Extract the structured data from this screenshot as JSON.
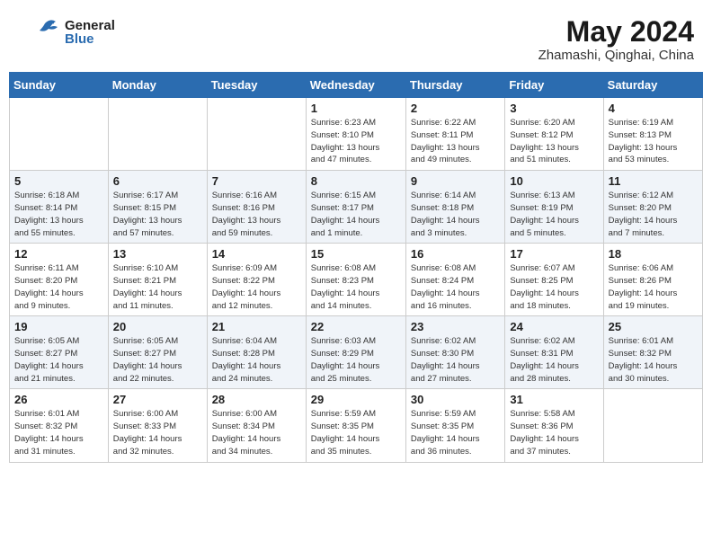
{
  "header": {
    "logo_general": "General",
    "logo_blue": "Blue",
    "month": "May 2024",
    "location": "Zhamashi, Qinghai, China"
  },
  "days_of_week": [
    "Sunday",
    "Monday",
    "Tuesday",
    "Wednesday",
    "Thursday",
    "Friday",
    "Saturday"
  ],
  "weeks": [
    [
      {
        "day": "",
        "info": ""
      },
      {
        "day": "",
        "info": ""
      },
      {
        "day": "",
        "info": ""
      },
      {
        "day": "1",
        "info": "Sunrise: 6:23 AM\nSunset: 8:10 PM\nDaylight: 13 hours\nand 47 minutes."
      },
      {
        "day": "2",
        "info": "Sunrise: 6:22 AM\nSunset: 8:11 PM\nDaylight: 13 hours\nand 49 minutes."
      },
      {
        "day": "3",
        "info": "Sunrise: 6:20 AM\nSunset: 8:12 PM\nDaylight: 13 hours\nand 51 minutes."
      },
      {
        "day": "4",
        "info": "Sunrise: 6:19 AM\nSunset: 8:13 PM\nDaylight: 13 hours\nand 53 minutes."
      }
    ],
    [
      {
        "day": "5",
        "info": "Sunrise: 6:18 AM\nSunset: 8:14 PM\nDaylight: 13 hours\nand 55 minutes."
      },
      {
        "day": "6",
        "info": "Sunrise: 6:17 AM\nSunset: 8:15 PM\nDaylight: 13 hours\nand 57 minutes."
      },
      {
        "day": "7",
        "info": "Sunrise: 6:16 AM\nSunset: 8:16 PM\nDaylight: 13 hours\nand 59 minutes."
      },
      {
        "day": "8",
        "info": "Sunrise: 6:15 AM\nSunset: 8:17 PM\nDaylight: 14 hours\nand 1 minute."
      },
      {
        "day": "9",
        "info": "Sunrise: 6:14 AM\nSunset: 8:18 PM\nDaylight: 14 hours\nand 3 minutes."
      },
      {
        "day": "10",
        "info": "Sunrise: 6:13 AM\nSunset: 8:19 PM\nDaylight: 14 hours\nand 5 minutes."
      },
      {
        "day": "11",
        "info": "Sunrise: 6:12 AM\nSunset: 8:20 PM\nDaylight: 14 hours\nand 7 minutes."
      }
    ],
    [
      {
        "day": "12",
        "info": "Sunrise: 6:11 AM\nSunset: 8:20 PM\nDaylight: 14 hours\nand 9 minutes."
      },
      {
        "day": "13",
        "info": "Sunrise: 6:10 AM\nSunset: 8:21 PM\nDaylight: 14 hours\nand 11 minutes."
      },
      {
        "day": "14",
        "info": "Sunrise: 6:09 AM\nSunset: 8:22 PM\nDaylight: 14 hours\nand 12 minutes."
      },
      {
        "day": "15",
        "info": "Sunrise: 6:08 AM\nSunset: 8:23 PM\nDaylight: 14 hours\nand 14 minutes."
      },
      {
        "day": "16",
        "info": "Sunrise: 6:08 AM\nSunset: 8:24 PM\nDaylight: 14 hours\nand 16 minutes."
      },
      {
        "day": "17",
        "info": "Sunrise: 6:07 AM\nSunset: 8:25 PM\nDaylight: 14 hours\nand 18 minutes."
      },
      {
        "day": "18",
        "info": "Sunrise: 6:06 AM\nSunset: 8:26 PM\nDaylight: 14 hours\nand 19 minutes."
      }
    ],
    [
      {
        "day": "19",
        "info": "Sunrise: 6:05 AM\nSunset: 8:27 PM\nDaylight: 14 hours\nand 21 minutes."
      },
      {
        "day": "20",
        "info": "Sunrise: 6:05 AM\nSunset: 8:27 PM\nDaylight: 14 hours\nand 22 minutes."
      },
      {
        "day": "21",
        "info": "Sunrise: 6:04 AM\nSunset: 8:28 PM\nDaylight: 14 hours\nand 24 minutes."
      },
      {
        "day": "22",
        "info": "Sunrise: 6:03 AM\nSunset: 8:29 PM\nDaylight: 14 hours\nand 25 minutes."
      },
      {
        "day": "23",
        "info": "Sunrise: 6:02 AM\nSunset: 8:30 PM\nDaylight: 14 hours\nand 27 minutes."
      },
      {
        "day": "24",
        "info": "Sunrise: 6:02 AM\nSunset: 8:31 PM\nDaylight: 14 hours\nand 28 minutes."
      },
      {
        "day": "25",
        "info": "Sunrise: 6:01 AM\nSunset: 8:32 PM\nDaylight: 14 hours\nand 30 minutes."
      }
    ],
    [
      {
        "day": "26",
        "info": "Sunrise: 6:01 AM\nSunset: 8:32 PM\nDaylight: 14 hours\nand 31 minutes."
      },
      {
        "day": "27",
        "info": "Sunrise: 6:00 AM\nSunset: 8:33 PM\nDaylight: 14 hours\nand 32 minutes."
      },
      {
        "day": "28",
        "info": "Sunrise: 6:00 AM\nSunset: 8:34 PM\nDaylight: 14 hours\nand 34 minutes."
      },
      {
        "day": "29",
        "info": "Sunrise: 5:59 AM\nSunset: 8:35 PM\nDaylight: 14 hours\nand 35 minutes."
      },
      {
        "day": "30",
        "info": "Sunrise: 5:59 AM\nSunset: 8:35 PM\nDaylight: 14 hours\nand 36 minutes."
      },
      {
        "day": "31",
        "info": "Sunrise: 5:58 AM\nSunset: 8:36 PM\nDaylight: 14 hours\nand 37 minutes."
      },
      {
        "day": "",
        "info": ""
      }
    ]
  ]
}
